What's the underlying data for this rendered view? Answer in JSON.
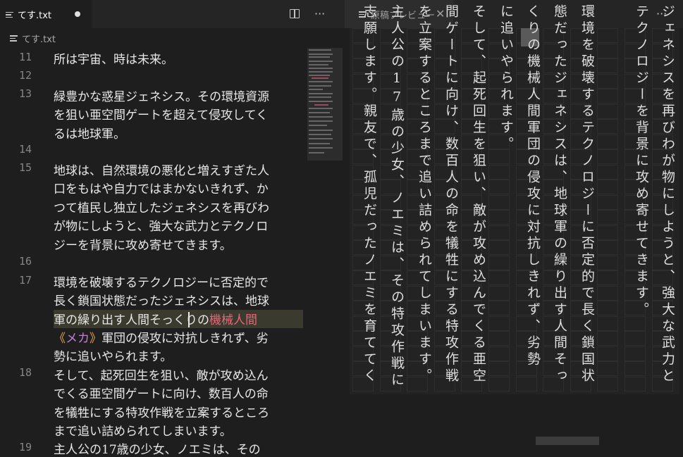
{
  "left_editor": {
    "tab_label": "てす.txt",
    "breadcrumb": "てす.txt",
    "icons": [
      "menu-lines-icon",
      "split-editor-icon",
      "more-icon"
    ]
  },
  "code": {
    "line_numbers": [
      "11",
      "12",
      "13",
      "14",
      "15",
      "16",
      "17",
      "18",
      "19"
    ],
    "line11": "所は宇宙、時は未来。",
    "line13a": "緑豊かな惑星ジェネシス。その環境資源",
    "line13b": "を狙い亜空間ゲートを超えて侵攻してく",
    "line13c": "るは地球軍。",
    "line15a": "地球は、自然環境の悪化と増えすぎた人",
    "line15b": "口をもはや自力ではまかないきれず、か",
    "line15c": "つて植民し独立したジェネシスを再びわ",
    "line15d": "が物にしようと、強大な武力とテクノロ",
    "line15e": "ジーを背景に攻め寄せてきます。",
    "line17a": "環境を破壊するテクノロジーに否定的で",
    "line17b": "長く鎖国状態だったジェネシスは、地球",
    "line17c_plain": "軍の繰り出す人間そっくりの",
    "line17c_ruby": "機械人間",
    "line17d_open": "《",
    "line17d_ruby": "メカ",
    "line17d_close": "》",
    "line17d_rest": "軍団の侵攻に対抗しきれず、劣",
    "line17e": "勢に追いやられます。",
    "line18a": "そして、起死回生を狙い、敵が攻め込ん",
    "line18b": "でくる亜空間ゲートに向け、数百人の命",
    "line18c": "を犠牲にする特攻作戦を立案するところ",
    "line18d": "まで追い詰められてしまいます。",
    "line19_partial": "主人公の17歳の少女、ノエミは、その"
  },
  "preview": {
    "tab_label": "原稿プレビュー",
    "columns": [
      "ジェネシスを再びわが物にしようと、強大な武力と",
      "テクノロジーを背景に攻め寄せてきます。",
      "環境を破壊するテクノロジーに否定的で長く鎖国状",
      "態だったジェネシスは、地球軍の繰り出す人間そっ",
      "くりの機械人間軍団の侵攻に対抗しきれず、劣勢",
      "に追いやられます。",
      "そして、起死回生を狙い、敵が攻め込んでくる亜空",
      "間ゲートに向け、数百人の命を犠牲にする特攻作戦",
      "を立案するところまで追い詰められてしまいます。",
      "主人公の17歳の少女、ノエミは、その特攻作戦に",
      "志願します。親友で、孤児だったノエミを育ててく"
    ]
  },
  "colors": {
    "editor_bg": "#1e1e1e",
    "ruby_pink": "#e8667a",
    "ruby_orange": "#e6a04d",
    "ruby_purple": "#c47fd5"
  }
}
